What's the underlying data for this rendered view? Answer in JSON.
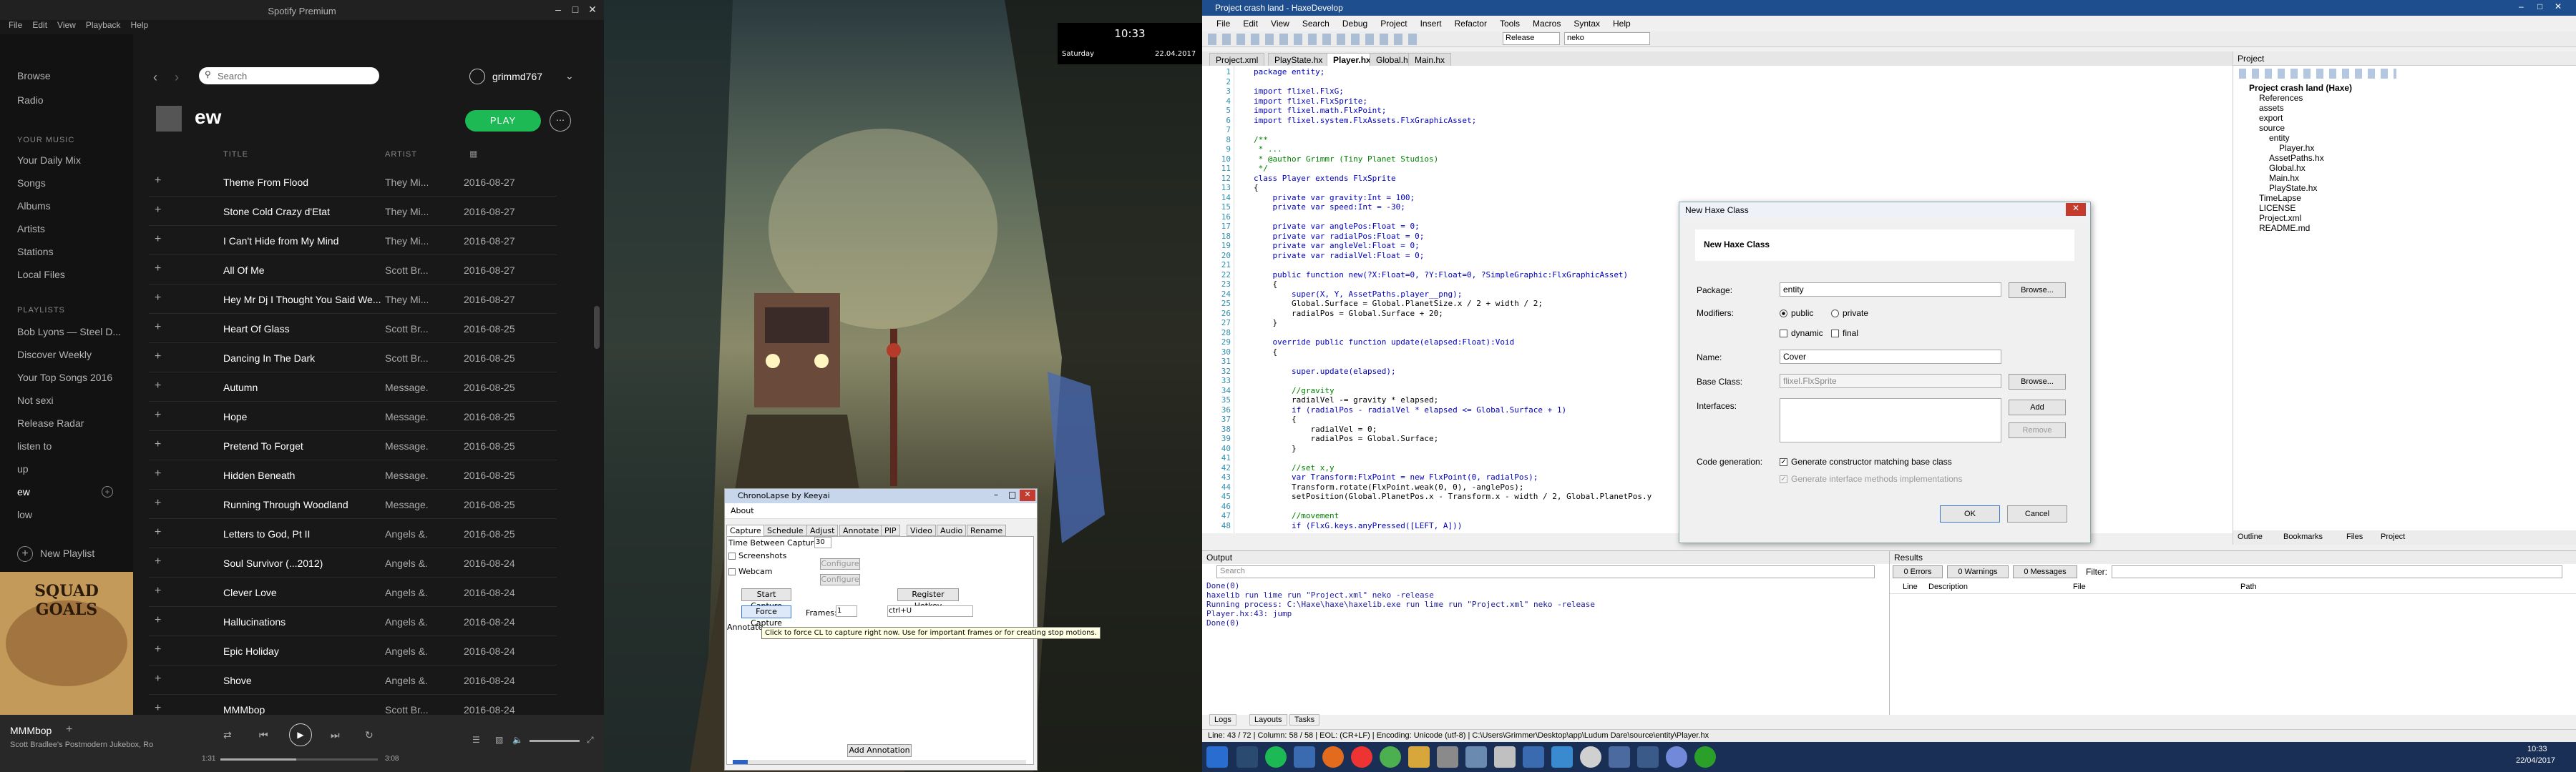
{
  "spotify": {
    "title": "Spotify Premium",
    "menu": [
      "File",
      "Edit",
      "View",
      "Playback",
      "Help"
    ],
    "nav": [
      "Browse",
      "Radio"
    ],
    "your_music_header": "YOUR MUSIC",
    "your_music": [
      "Your Daily Mix",
      "Songs",
      "Albums",
      "Artists",
      "Stations",
      "Local Files"
    ],
    "playlists_header": "PLAYLISTS",
    "playlists": [
      "Bob Lyons — Steel D...",
      "Discover Weekly",
      "Your Top Songs 2016",
      "Not sexi",
      "Release Radar",
      "listen to",
      "up",
      "ew",
      "low"
    ],
    "new_playlist": "New Playlist",
    "search_placeholder": "Search",
    "username": "grimmd767",
    "playlist_name": "ew",
    "play_label": "PLAY",
    "col_title": "TITLE",
    "col_artist": "ARTIST",
    "rows": [
      [
        "Theme From Flood",
        "They Mi...",
        "2016-08-27"
      ],
      [
        "Stone Cold Crazy d'Etat",
        "They Mi...",
        "2016-08-27"
      ],
      [
        "I Can't Hide from My Mind",
        "They Mi...",
        "2016-08-27"
      ],
      [
        "All Of Me",
        "Scott Br...",
        "2016-08-27"
      ],
      [
        "Hey Mr Dj I Thought You Said We...",
        "They Mi...",
        "2016-08-27"
      ],
      [
        "Heart Of Glass",
        "Scott Br...",
        "2016-08-25"
      ],
      [
        "Dancing In The Dark",
        "Scott Br...",
        "2016-08-25"
      ],
      [
        "Autumn",
        "Message...",
        "2016-08-25"
      ],
      [
        "Hope",
        "Message...",
        "2016-08-25"
      ],
      [
        "Pretend To Forget",
        "Message...",
        "2016-08-25"
      ],
      [
        "Hidden Beneath",
        "Message...",
        "2016-08-25"
      ],
      [
        "Running Through Woodland",
        "Message...",
        "2016-08-25"
      ],
      [
        "Letters to God, Pt II",
        "Angels &...",
        "2016-08-25"
      ],
      [
        "Soul Survivor (...2012)",
        "Angels &...",
        "2016-08-24"
      ],
      [
        "Clever Love",
        "Angels &...",
        "2016-08-24"
      ],
      [
        "Hallucinations",
        "Angels &...",
        "2016-08-24"
      ],
      [
        "Epic Holiday",
        "Angels &...",
        "2016-08-24"
      ],
      [
        "Shove",
        "Angels &...",
        "2016-08-24"
      ],
      [
        "MMMbop",
        "Scott Br...",
        "2016-08-24"
      ]
    ],
    "now_playing_title": "MMMbop",
    "now_playing_artist": "Scott Bradlee's Postmodern Jukebox, Ro",
    "time_elapsed": "1:31",
    "time_total": "3:08",
    "album_text": "SQUAD GOALS"
  },
  "clock": {
    "time": "10:33",
    "day": "Saturday",
    "date": "22.04.2017"
  },
  "chrono": {
    "title": "ChronoLapse by Keeyai",
    "menu": "About",
    "tabs": [
      "Capture",
      "Schedule",
      "Adjust",
      "Annotate",
      "PIP",
      "Video",
      "Audio",
      "Rename"
    ],
    "time_between": "Time Between Captures:",
    "time_value": "30",
    "screenshots": "Screenshots",
    "webcam": "Webcam",
    "configure": "Configure",
    "start_capture": "Start Capture",
    "register_hotkey": "Register Hotkey",
    "force_capture": "Force Capture",
    "frames_label": "Frames:",
    "frames_value": "1",
    "hotkey_value": "ctrl+U",
    "annotate_label": "Annotate",
    "tooltip": "Click to force CL to capture right now. Use for important frames or for creating stop motions.",
    "add_annotation": "Add Annotation"
  },
  "haxe": {
    "title": "Project crash land - HaxeDevelop",
    "menu": [
      "File",
      "Edit",
      "View",
      "Search",
      "Debug",
      "Project",
      "Insert",
      "Refactor",
      "Tools",
      "Macros",
      "Syntax",
      "Help"
    ],
    "config": "Release",
    "target": "neko",
    "tabs": [
      "Project.xml",
      "PlayState.hx",
      "Player.hx",
      "Global.hx",
      "Main.hx"
    ],
    "code": [
      [
        "1",
        "package entity;"
      ],
      [
        "2",
        ""
      ],
      [
        "3",
        "import flixel.FlxG;"
      ],
      [
        "4",
        "import flixel.FlxSprite;"
      ],
      [
        "5",
        "import flixel.math.FlxPoint;"
      ],
      [
        "6",
        "import flixel.system.FlxAssets.FlxGraphicAsset;"
      ],
      [
        "7",
        ""
      ],
      [
        "8",
        "/**"
      ],
      [
        "9",
        " * ..."
      ],
      [
        "10",
        " * @author Grimmr (Tiny Planet Studios)"
      ],
      [
        "11",
        " */"
      ],
      [
        "12",
        "class Player extends FlxSprite"
      ],
      [
        "13",
        "{"
      ],
      [
        "14",
        "    private var gravity:Int = 100;"
      ],
      [
        "15",
        "    private var speed:Int = -30;"
      ],
      [
        "16",
        ""
      ],
      [
        "17",
        "    private var anglePos:Float = 0;"
      ],
      [
        "18",
        "    private var radialPos:Float = 0;"
      ],
      [
        "19",
        "    private var angleVel:Float = 0;"
      ],
      [
        "20",
        "    private var radialVel:Float = 0;"
      ],
      [
        "21",
        ""
      ],
      [
        "22",
        "    public function new(?X:Float=0, ?Y:Float=0, ?SimpleGraphic:FlxGraphicAsset)"
      ],
      [
        "23",
        "    {"
      ],
      [
        "24",
        "        super(X, Y, AssetPaths.player__png);"
      ],
      [
        "25",
        "        Global.Surface = Global.PlanetSize.x / 2 + width / 2;"
      ],
      [
        "26",
        "        radialPos = Global.Surface + 20;"
      ],
      [
        "27",
        "    }"
      ],
      [
        "28",
        ""
      ],
      [
        "29",
        "    override public function update(elapsed:Float):Void"
      ],
      [
        "30",
        "    {"
      ],
      [
        "31",
        ""
      ],
      [
        "32",
        "        super.update(elapsed);"
      ],
      [
        "33",
        ""
      ],
      [
        "34",
        "        //gravity"
      ],
      [
        "35",
        "        radialVel -= gravity * elapsed;"
      ],
      [
        "36",
        "        if (radialPos - radialVel * elapsed <= Global.Surface + 1)"
      ],
      [
        "37",
        "        {"
      ],
      [
        "38",
        "            radialVel = 0;"
      ],
      [
        "39",
        "            radialPos = Global.Surface;"
      ],
      [
        "40",
        "        }"
      ],
      [
        "41",
        ""
      ],
      [
        "42",
        "        //set x,y"
      ],
      [
        "43",
        "        var Transform:FlxPoint = new FlxPoint(0, radialPos);"
      ],
      [
        "44",
        "        Transform.rotate(FlxPoint.weak(0, 0), -anglePos);"
      ],
      [
        "45",
        "        setPosition(Global.PlanetPos.x - Transform.x - width / 2, Global.PlanetPos.y"
      ],
      [
        "46",
        ""
      ],
      [
        "47",
        "        //movement"
      ],
      [
        "48",
        "        if (FlxG.keys.anyPressed([LEFT, A]))"
      ]
    ],
    "project_title": "Project",
    "tree": [
      [
        "Project crash land (Haxe)",
        0
      ],
      [
        "References",
        1
      ],
      [
        "assets",
        1
      ],
      [
        "export",
        1
      ],
      [
        "source",
        1
      ],
      [
        "entity",
        2
      ],
      [
        "Player.hx",
        3
      ],
      [
        "AssetPaths.hx",
        2
      ],
      [
        "Global.hx",
        2
      ],
      [
        "Main.hx",
        2
      ],
      [
        "PlayState.hx",
        2
      ],
      [
        "TimeLapse",
        1
      ],
      [
        "LICENSE",
        1
      ],
      [
        "Project.xml",
        1
      ],
      [
        "README.md",
        1
      ]
    ],
    "panel_tabs": [
      "Outline",
      "Bookmarks",
      "Files",
      "Project"
    ],
    "dialog": {
      "title": "New Haxe Class",
      "header": "New Haxe Class",
      "package_label": "Package:",
      "package_value": "entity",
      "browse": "Browse...",
      "modifiers_label": "Modifiers:",
      "public": "public",
      "private": "private",
      "dynamic": "dynamic",
      "final": "final",
      "name_label": "Name:",
      "name_value": "Cover",
      "base_label": "Base Class:",
      "base_value": "flixel.FlxSprite",
      "interfaces_label": "Interfaces:",
      "add": "Add",
      "remove": "Remove",
      "codegen_label": "Code generation:",
      "gen1": "Generate constructor matching base class",
      "gen2": "Generate interface methods implementations",
      "ok": "OK",
      "cancel": "Cancel"
    },
    "output_title": "Output",
    "output_search": "Search",
    "output_lines": [
      "Done(0)",
      "haxelib run lime run \"Project.xml\" neko -release",
      "Running process: C:\\Haxe\\haxe\\haxelib.exe run lime run \"Project.xml\" neko -release",
      "Player.hx:43: jump",
      "Done(0)"
    ],
    "results_title": "Results",
    "errors": "0 Errors",
    "warnings": "0 Warnings",
    "messages": "0 Messages",
    "filter": "Filter:",
    "results_cols": [
      "Line",
      "Description",
      "File",
      "Path"
    ],
    "bottom_tabs": [
      "Logs",
      "Layouts",
      "Tasks"
    ],
    "status": "Line: 43 / 72  |  Column: 58 / 58  |  EOL: (CR+LF)  |  Encoding: Unicode (utf-8)  |  C:\\Users\\Grimmer\\Desktop\\app\\Ludum Dare\\source\\entity\\Player.hx",
    "tray_time": "10:33",
    "tray_date": "22/04/2017"
  }
}
